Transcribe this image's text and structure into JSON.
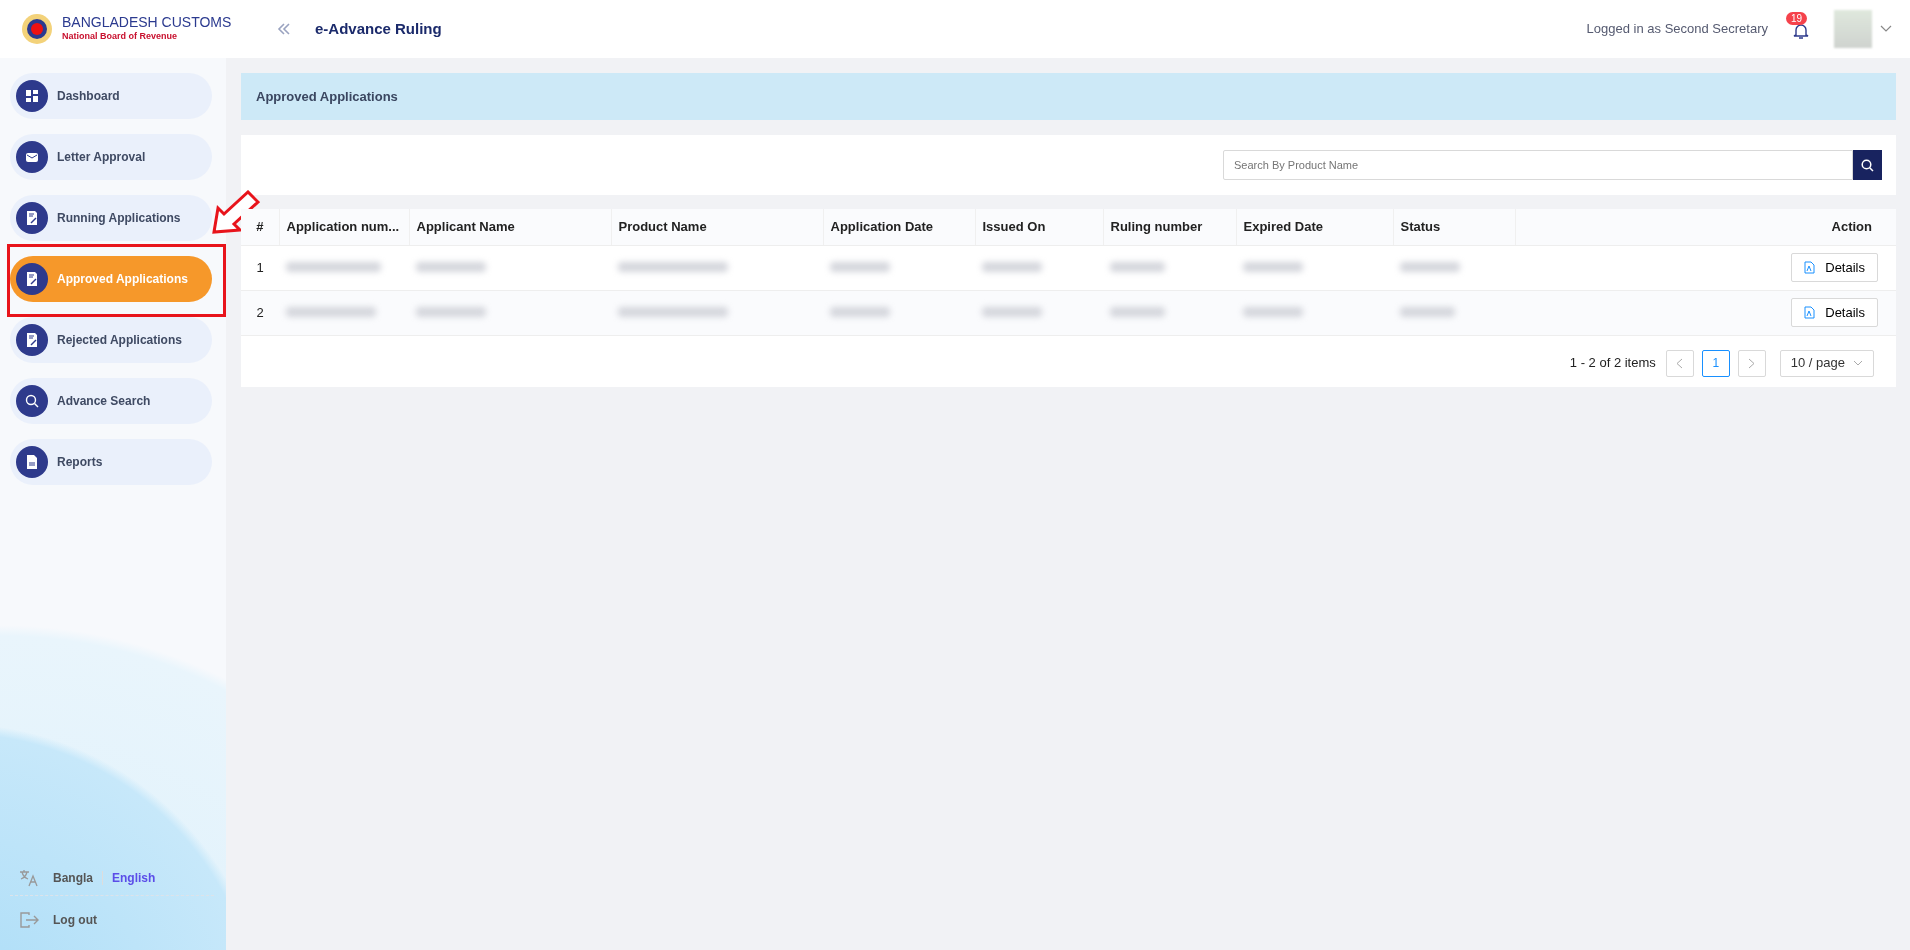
{
  "header": {
    "logo_title": "BANGLADESH CUSTOMS",
    "logo_subtitle": "National Board of Revenue",
    "app_title": "e-Advance Ruling",
    "logged_in": "Logged in as Second Secretary",
    "notification_count": "19"
  },
  "sidebar": {
    "items": [
      {
        "label": "Dashboard",
        "kind": "grid",
        "selected": false
      },
      {
        "label": "Letter Approval",
        "kind": "mail",
        "selected": false
      },
      {
        "label": "Running Applications",
        "kind": "doc",
        "selected": false
      },
      {
        "label": "Approved Applications",
        "kind": "doc",
        "selected": true
      },
      {
        "label": "Rejected Applications",
        "kind": "doc",
        "selected": false
      },
      {
        "label": "Advance Search",
        "kind": "search",
        "selected": false
      },
      {
        "label": "Reports",
        "kind": "file",
        "selected": false
      }
    ],
    "languages": [
      {
        "label": "Bangla",
        "selected": false
      },
      {
        "label": "English",
        "selected": true
      }
    ],
    "logout": "Log out"
  },
  "page_title": "Approved Applications",
  "search": {
    "placeholder": "Search By Product Name"
  },
  "table": {
    "columns": [
      "#",
      "Application num...",
      "Applicant Name",
      "Product Name",
      "Application Date",
      "Issued On",
      "Ruling number",
      "Expired Date",
      "Status",
      "Action"
    ],
    "rows": [
      {
        "index": "1",
        "action": "Details"
      },
      {
        "index": "2",
        "action": "Details"
      }
    ]
  },
  "pagination": {
    "summary": "1 - 2 of 2 items",
    "pages": [
      {
        "label": "1",
        "selected": true
      }
    ],
    "page_size": "10 / page"
  }
}
